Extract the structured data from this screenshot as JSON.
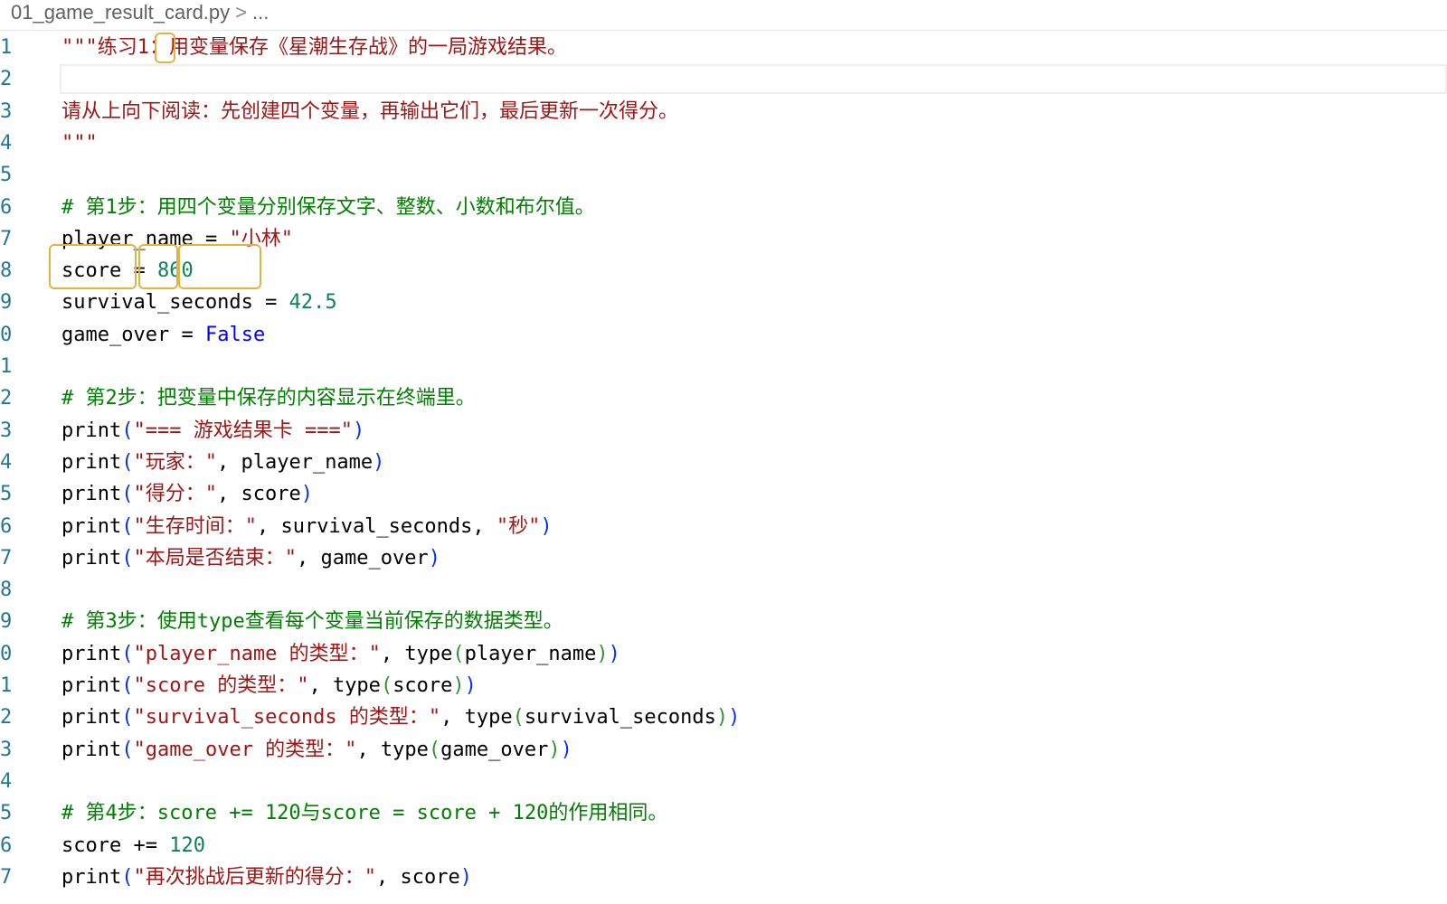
{
  "breadcrumb": {
    "file": "01_game_result_card.py",
    "chevron": ">",
    "more": "..."
  },
  "editor": {
    "lines": [
      {
        "num": "1",
        "tokens": [
          {
            "t": "\"\"\"练习1：用变量保存《星潮生存战》的一局游戏结果。",
            "c": "str"
          }
        ]
      },
      {
        "num": "2",
        "tokens": []
      },
      {
        "num": "3",
        "tokens": [
          {
            "t": "请从上向下阅读：先创建四个变量，再输出它们，最后更新一次得分。",
            "c": "str"
          }
        ]
      },
      {
        "num": "4",
        "tokens": [
          {
            "t": "\"\"\"",
            "c": "str"
          }
        ]
      },
      {
        "num": "5",
        "tokens": []
      },
      {
        "num": "6",
        "tokens": [
          {
            "t": "# 第1步：用四个变量分别保存文字、整数、小数和布尔值。",
            "c": "com"
          }
        ]
      },
      {
        "num": "7",
        "tokens": [
          {
            "t": "player_name",
            "c": "var"
          },
          {
            "t": " = ",
            "c": "op"
          },
          {
            "t": "\"小林\"",
            "c": "str"
          }
        ]
      },
      {
        "num": "8",
        "tokens": [
          {
            "t": "score",
            "c": "var"
          },
          {
            "t": " = ",
            "c": "op"
          },
          {
            "t": "860",
            "c": "num"
          }
        ]
      },
      {
        "num": "9",
        "tokens": [
          {
            "t": "survival_seconds",
            "c": "var"
          },
          {
            "t": " = ",
            "c": "op"
          },
          {
            "t": "42.5",
            "c": "num"
          }
        ]
      },
      {
        "num": "0",
        "tokens": [
          {
            "t": "game_over",
            "c": "var"
          },
          {
            "t": " = ",
            "c": "op"
          },
          {
            "t": "False",
            "c": "kw"
          }
        ]
      },
      {
        "num": "1",
        "tokens": []
      },
      {
        "num": "2",
        "tokens": [
          {
            "t": "# 第2步：把变量中保存的内容显示在终端里。",
            "c": "com"
          }
        ]
      },
      {
        "num": "3",
        "tokens": [
          {
            "t": "print",
            "c": "fn"
          },
          {
            "t": "(",
            "c": "p1"
          },
          {
            "t": "\"=== 游戏结果卡 ===\"",
            "c": "str"
          },
          {
            "t": ")",
            "c": "p1"
          }
        ]
      },
      {
        "num": "4",
        "tokens": [
          {
            "t": "print",
            "c": "fn"
          },
          {
            "t": "(",
            "c": "p1"
          },
          {
            "t": "\"玩家：\"",
            "c": "str"
          },
          {
            "t": ", player_name",
            "c": "var"
          },
          {
            "t": ")",
            "c": "p1"
          }
        ]
      },
      {
        "num": "5",
        "tokens": [
          {
            "t": "print",
            "c": "fn"
          },
          {
            "t": "(",
            "c": "p1"
          },
          {
            "t": "\"得分：\"",
            "c": "str"
          },
          {
            "t": ", score",
            "c": "var"
          },
          {
            "t": ")",
            "c": "p1"
          }
        ]
      },
      {
        "num": "6",
        "tokens": [
          {
            "t": "print",
            "c": "fn"
          },
          {
            "t": "(",
            "c": "p1"
          },
          {
            "t": "\"生存时间：\"",
            "c": "str"
          },
          {
            "t": ", survival_seconds, ",
            "c": "var"
          },
          {
            "t": "\"秒\"",
            "c": "str"
          },
          {
            "t": ")",
            "c": "p1"
          }
        ]
      },
      {
        "num": "7",
        "tokens": [
          {
            "t": "print",
            "c": "fn"
          },
          {
            "t": "(",
            "c": "p1"
          },
          {
            "t": "\"本局是否结束：\"",
            "c": "str"
          },
          {
            "t": ", game_over",
            "c": "var"
          },
          {
            "t": ")",
            "c": "p1"
          }
        ]
      },
      {
        "num": "8",
        "tokens": []
      },
      {
        "num": "9",
        "tokens": [
          {
            "t": "# 第3步：使用type查看每个变量当前保存的数据类型。",
            "c": "com"
          }
        ]
      },
      {
        "num": "0",
        "tokens": [
          {
            "t": "print",
            "c": "fn"
          },
          {
            "t": "(",
            "c": "p1"
          },
          {
            "t": "\"player_name 的类型：\"",
            "c": "str"
          },
          {
            "t": ", type",
            "c": "var"
          },
          {
            "t": "(",
            "c": "p2"
          },
          {
            "t": "player_name",
            "c": "var"
          },
          {
            "t": ")",
            "c": "p2"
          },
          {
            "t": ")",
            "c": "p1"
          }
        ]
      },
      {
        "num": "1",
        "tokens": [
          {
            "t": "print",
            "c": "fn"
          },
          {
            "t": "(",
            "c": "p1"
          },
          {
            "t": "\"score 的类型：\"",
            "c": "str"
          },
          {
            "t": ", type",
            "c": "var"
          },
          {
            "t": "(",
            "c": "p2"
          },
          {
            "t": "score",
            "c": "var"
          },
          {
            "t": ")",
            "c": "p2"
          },
          {
            "t": ")",
            "c": "p1"
          }
        ]
      },
      {
        "num": "2",
        "tokens": [
          {
            "t": "print",
            "c": "fn"
          },
          {
            "t": "(",
            "c": "p1"
          },
          {
            "t": "\"survival_seconds 的类型：\"",
            "c": "str"
          },
          {
            "t": ", type",
            "c": "var"
          },
          {
            "t": "(",
            "c": "p2"
          },
          {
            "t": "survival_seconds",
            "c": "var"
          },
          {
            "t": ")",
            "c": "p2"
          },
          {
            "t": ")",
            "c": "p1"
          }
        ]
      },
      {
        "num": "3",
        "tokens": [
          {
            "t": "print",
            "c": "fn"
          },
          {
            "t": "(",
            "c": "p1"
          },
          {
            "t": "\"game_over 的类型：\"",
            "c": "str"
          },
          {
            "t": ", type",
            "c": "var"
          },
          {
            "t": "(",
            "c": "p2"
          },
          {
            "t": "game_over",
            "c": "var"
          },
          {
            "t": ")",
            "c": "p2"
          },
          {
            "t": ")",
            "c": "p1"
          }
        ]
      },
      {
        "num": "4",
        "tokens": []
      },
      {
        "num": "5",
        "tokens": [
          {
            "t": "# 第4步：score += 120与score = score + 120的作用相同。",
            "c": "com"
          }
        ]
      },
      {
        "num": "6",
        "tokens": [
          {
            "t": "score",
            "c": "var"
          },
          {
            "t": " += ",
            "c": "op"
          },
          {
            "t": "120",
            "c": "num"
          }
        ]
      },
      {
        "num": "7",
        "tokens": [
          {
            "t": "print",
            "c": "fn"
          },
          {
            "t": "(",
            "c": "p1"
          },
          {
            "t": "\"再次挑战后更新的得分：\"",
            "c": "str"
          },
          {
            "t": ", score",
            "c": "var"
          },
          {
            "t": ")",
            "c": "p1"
          }
        ]
      }
    ]
  },
  "colors": {
    "string": "#a31515",
    "comment": "#008000",
    "number": "#098658",
    "keyword": "#0000ff",
    "line_number": "#237893",
    "bracket_level1": "#0431fa",
    "bracket_level2": "#319331",
    "highlight_border": "#e3b341"
  }
}
